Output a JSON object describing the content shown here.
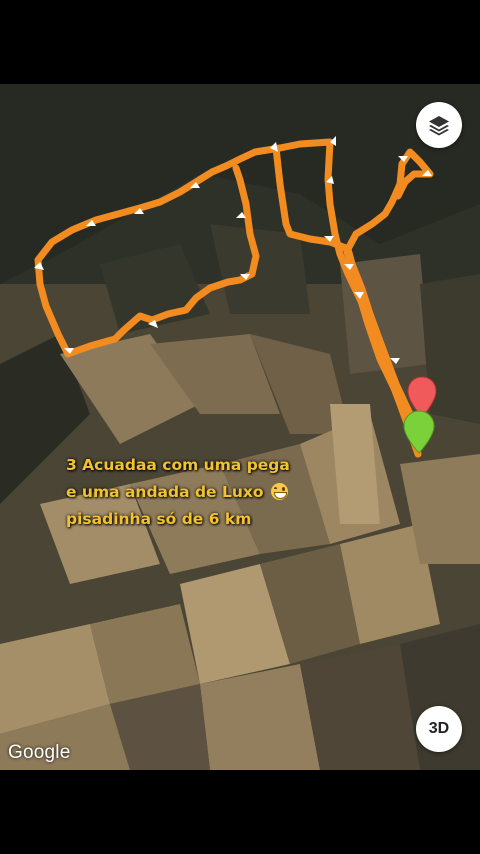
{
  "caption": {
    "line1": "3 Acuadaa com uma pega",
    "line2": "e uma andada  de Luxo",
    "line3": "pisadinha só de 6 km"
  },
  "map": {
    "attribution": "Google",
    "button_3d": "3D",
    "layers_icon": "layers-icon",
    "track_color": "#f28b20",
    "start_pin_color": "#7bd13a",
    "end_pin_color": "#f05a5a"
  }
}
